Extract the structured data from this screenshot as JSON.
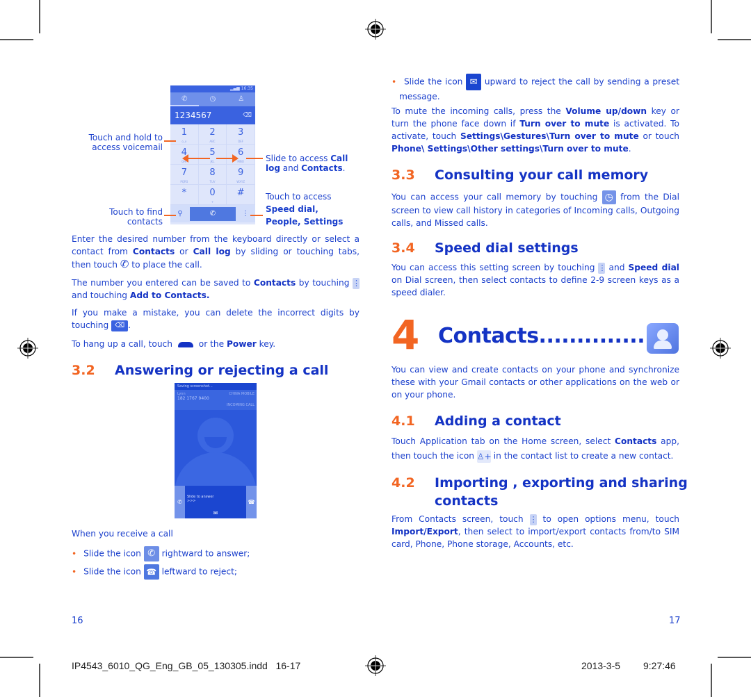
{
  "left_page": {
    "dialer_screenshot": {
      "status_time": "16:35",
      "tabs": [
        "phone-tab",
        "call-log-tab",
        "contacts-tab"
      ],
      "number": "1234567",
      "keys": [
        {
          "digit": "1",
          "sub": "o_o"
        },
        {
          "digit": "2",
          "sub": "ABC"
        },
        {
          "digit": "3",
          "sub": "DEF"
        },
        {
          "digit": "4",
          "sub": "GHI"
        },
        {
          "digit": "5",
          "sub": "JKL"
        },
        {
          "digit": "6",
          "sub": "MNO"
        },
        {
          "digit": "7",
          "sub": "PQRS"
        },
        {
          "digit": "8",
          "sub": "TUV"
        },
        {
          "digit": "9",
          "sub": "WXYZ"
        },
        {
          "digit": "*",
          "sub": ""
        },
        {
          "digit": "0",
          "sub": "+"
        },
        {
          "digit": "#",
          "sub": ""
        }
      ]
    },
    "callouts": {
      "voicemail_1": "Touch and hold to",
      "voicemail_2": "access voicemail",
      "slide_1": "Slide to access ",
      "slide_call": "Call",
      "slide_log": "log",
      "slide_and": " and ",
      "slide_contacts": "Contacts",
      "slide_end": ".",
      "find_1": "Touch to find",
      "find_2": "contacts",
      "access_1": "Touch to access",
      "access_2": "Speed dial,",
      "access_3": "People, Settings"
    },
    "para1": {
      "t1": "Enter the desired number from the keyboard directly or select a contact from ",
      "b1": "Contacts",
      "t2": " or ",
      "b2": "Call log",
      "t3": " by sliding or touching tabs, then touch ",
      "t4": " to place the call."
    },
    "para2": {
      "t1": "The number you entered can be saved to ",
      "b1": "Contacts",
      "t2": " by touching ",
      "t3": " and touching ",
      "b2": "Add to Contacts."
    },
    "para3": {
      "t1": "If you make a mistake, you can delete the incorrect digits by touching ",
      "t2": "."
    },
    "para4": {
      "t1": "To hang up a call, touch ",
      "t2": " or the ",
      "b1": "Power",
      "t3": " key."
    },
    "section_3_2": {
      "num": "3.2",
      "title": "Answering or rejecting a call"
    },
    "incoming_screenshot": {
      "status": "Saving screenshot...",
      "caller": "Lynn",
      "phone": "182 1767 9400",
      "carrier": "CHINA MOBILE",
      "label": "INCOMING CALL",
      "slide_text": "Slide to answer",
      "arrows": ">>>"
    },
    "receive_intro": "When you receive a call",
    "bullets": [
      {
        "t1": "Slide the icon ",
        "t2": " rightward to answer;"
      },
      {
        "t1": "Slide the icon ",
        "t2": " leftward to reject;"
      }
    ],
    "page_number": "16"
  },
  "right_page": {
    "bullet3": {
      "t1": "Slide the icon ",
      "t2": " upward to reject the call by sending a preset message."
    },
    "mute_para": {
      "t1": "To mute the incoming calls, press the ",
      "b1": "Volume up/down",
      "t2": " key or turn the phone face down if ",
      "b2": "Turn over to mute",
      "t3": " is activated. To activate, touch ",
      "b3": "Settings\\Gestures\\Turn over to mute",
      "t4": " or touch ",
      "b4": "Phone\\ Settings\\Other settings\\Turn over to mute",
      "t5": "."
    },
    "section_3_3": {
      "num": "3.3",
      "title": "Consulting your call memory"
    },
    "para_3_3": {
      "t1": "You can access your call memory by touching ",
      "t2": " from the Dial screen to view call history in categories of Incoming calls, Outgoing calls, and Missed calls."
    },
    "section_3_4": {
      "num": "3.4",
      "title": "Speed dial settings"
    },
    "para_3_4": {
      "t1": "You can access this setting screen by touching ",
      "t2": " and ",
      "b1": "Speed dial",
      "t3": " on Dial screen, then select contacts to define 2-9 screen keys as a speed dialer."
    },
    "chapter": {
      "num": "4",
      "title": "Contacts.................."
    },
    "para_4": "You can view and create contacts on your phone and synchronize these with your Gmail contacts or other applications on the web or on your phone.",
    "section_4_1": {
      "num": "4.1",
      "title": "Adding a contact"
    },
    "para_4_1": {
      "t1": "Touch Application tab on the Home screen, select ",
      "b1": "Contacts",
      "t2": " app, then touch the icon ",
      "t3": " in the contact list to create a new contact."
    },
    "section_4_2": {
      "num": "4.2",
      "title_1": "Importing , exporting and sharing",
      "title_2": "contacts"
    },
    "para_4_2": {
      "t1": "From Contacts screen, touch ",
      "t2": " to open options menu, touch ",
      "b1": "Import/Export",
      "t3": ", then select to import/export contacts from/to SIM card, Phone, Phone storage, Accounts, etc."
    },
    "page_number": "17"
  },
  "footer": {
    "file": "IP4543_6010_QG_Eng_GB_05_130305.indd   16-17",
    "date": "2013-3-5",
    "time": "9:27:46"
  },
  "colors": {
    "text_blue": "#1a3fcc",
    "heading_blue": "#1433c4",
    "accent_orange": "#f26522",
    "icon_blue": "#4f78e0"
  }
}
